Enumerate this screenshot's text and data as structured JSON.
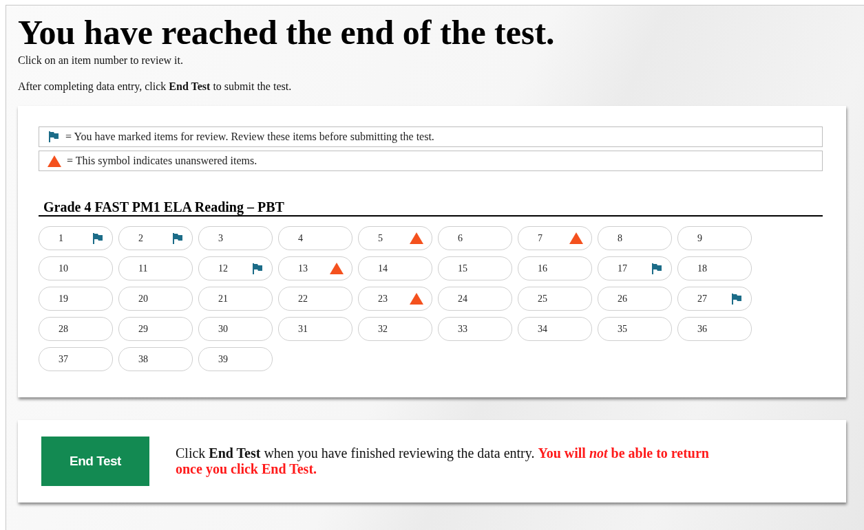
{
  "title": "You have reached the end of the test.",
  "instructions": [
    "Click on an item number to review it.",
    "After completing data entry, click **End Test** to submit the test."
  ],
  "legend": [
    {
      "kind": "marked",
      "text": "= You have marked items for review. Review these items before submitting the test."
    },
    {
      "kind": "unanswered",
      "text": "= This symbol indicates unanswered items."
    }
  ],
  "section_title": "Grade 4 FAST PM1 ELA Reading – PBT",
  "items": [
    {
      "number": "1",
      "marked": true,
      "unanswered": false
    },
    {
      "number": "2",
      "marked": true,
      "unanswered": false
    },
    {
      "number": "3",
      "marked": false,
      "unanswered": false
    },
    {
      "number": "4",
      "marked": false,
      "unanswered": false
    },
    {
      "number": "5",
      "marked": false,
      "unanswered": true
    },
    {
      "number": "6",
      "marked": false,
      "unanswered": false
    },
    {
      "number": "7",
      "marked": false,
      "unanswered": true
    },
    {
      "number": "8",
      "marked": false,
      "unanswered": false
    },
    {
      "number": "9",
      "marked": false,
      "unanswered": false
    },
    {
      "number": "10",
      "marked": false,
      "unanswered": false
    },
    {
      "number": "11",
      "marked": false,
      "unanswered": false
    },
    {
      "number": "12",
      "marked": true,
      "unanswered": false
    },
    {
      "number": "13",
      "marked": false,
      "unanswered": true
    },
    {
      "number": "14",
      "marked": false,
      "unanswered": false
    },
    {
      "number": "15",
      "marked": false,
      "unanswered": false
    },
    {
      "number": "16",
      "marked": false,
      "unanswered": false
    },
    {
      "number": "17",
      "marked": true,
      "unanswered": false
    },
    {
      "number": "18",
      "marked": false,
      "unanswered": false
    },
    {
      "number": "19",
      "marked": false,
      "unanswered": false
    },
    {
      "number": "20",
      "marked": false,
      "unanswered": false
    },
    {
      "number": "21",
      "marked": false,
      "unanswered": false
    },
    {
      "number": "22",
      "marked": false,
      "unanswered": false
    },
    {
      "number": "23",
      "marked": false,
      "unanswered": true
    },
    {
      "number": "24",
      "marked": false,
      "unanswered": false
    },
    {
      "number": "25",
      "marked": false,
      "unanswered": false
    },
    {
      "number": "26",
      "marked": false,
      "unanswered": false
    },
    {
      "number": "27",
      "marked": true,
      "unanswered": false
    },
    {
      "number": "28",
      "marked": false,
      "unanswered": false
    },
    {
      "number": "29",
      "marked": false,
      "unanswered": false
    },
    {
      "number": "30",
      "marked": false,
      "unanswered": false
    },
    {
      "number": "31",
      "marked": false,
      "unanswered": false
    },
    {
      "number": "32",
      "marked": false,
      "unanswered": false
    },
    {
      "number": "33",
      "marked": false,
      "unanswered": false
    },
    {
      "number": "34",
      "marked": false,
      "unanswered": false
    },
    {
      "number": "35",
      "marked": false,
      "unanswered": false
    },
    {
      "number": "36",
      "marked": false,
      "unanswered": false
    },
    {
      "number": "37",
      "marked": false,
      "unanswered": false
    },
    {
      "number": "38",
      "marked": false,
      "unanswered": false
    },
    {
      "number": "39",
      "marked": false,
      "unanswered": false
    }
  ],
  "end_button": "End Test",
  "end_note": "Click **End Test** when you have finished reviewing the data entry.",
  "end_warning": "You will *not* be able to return once you click End Test."
}
